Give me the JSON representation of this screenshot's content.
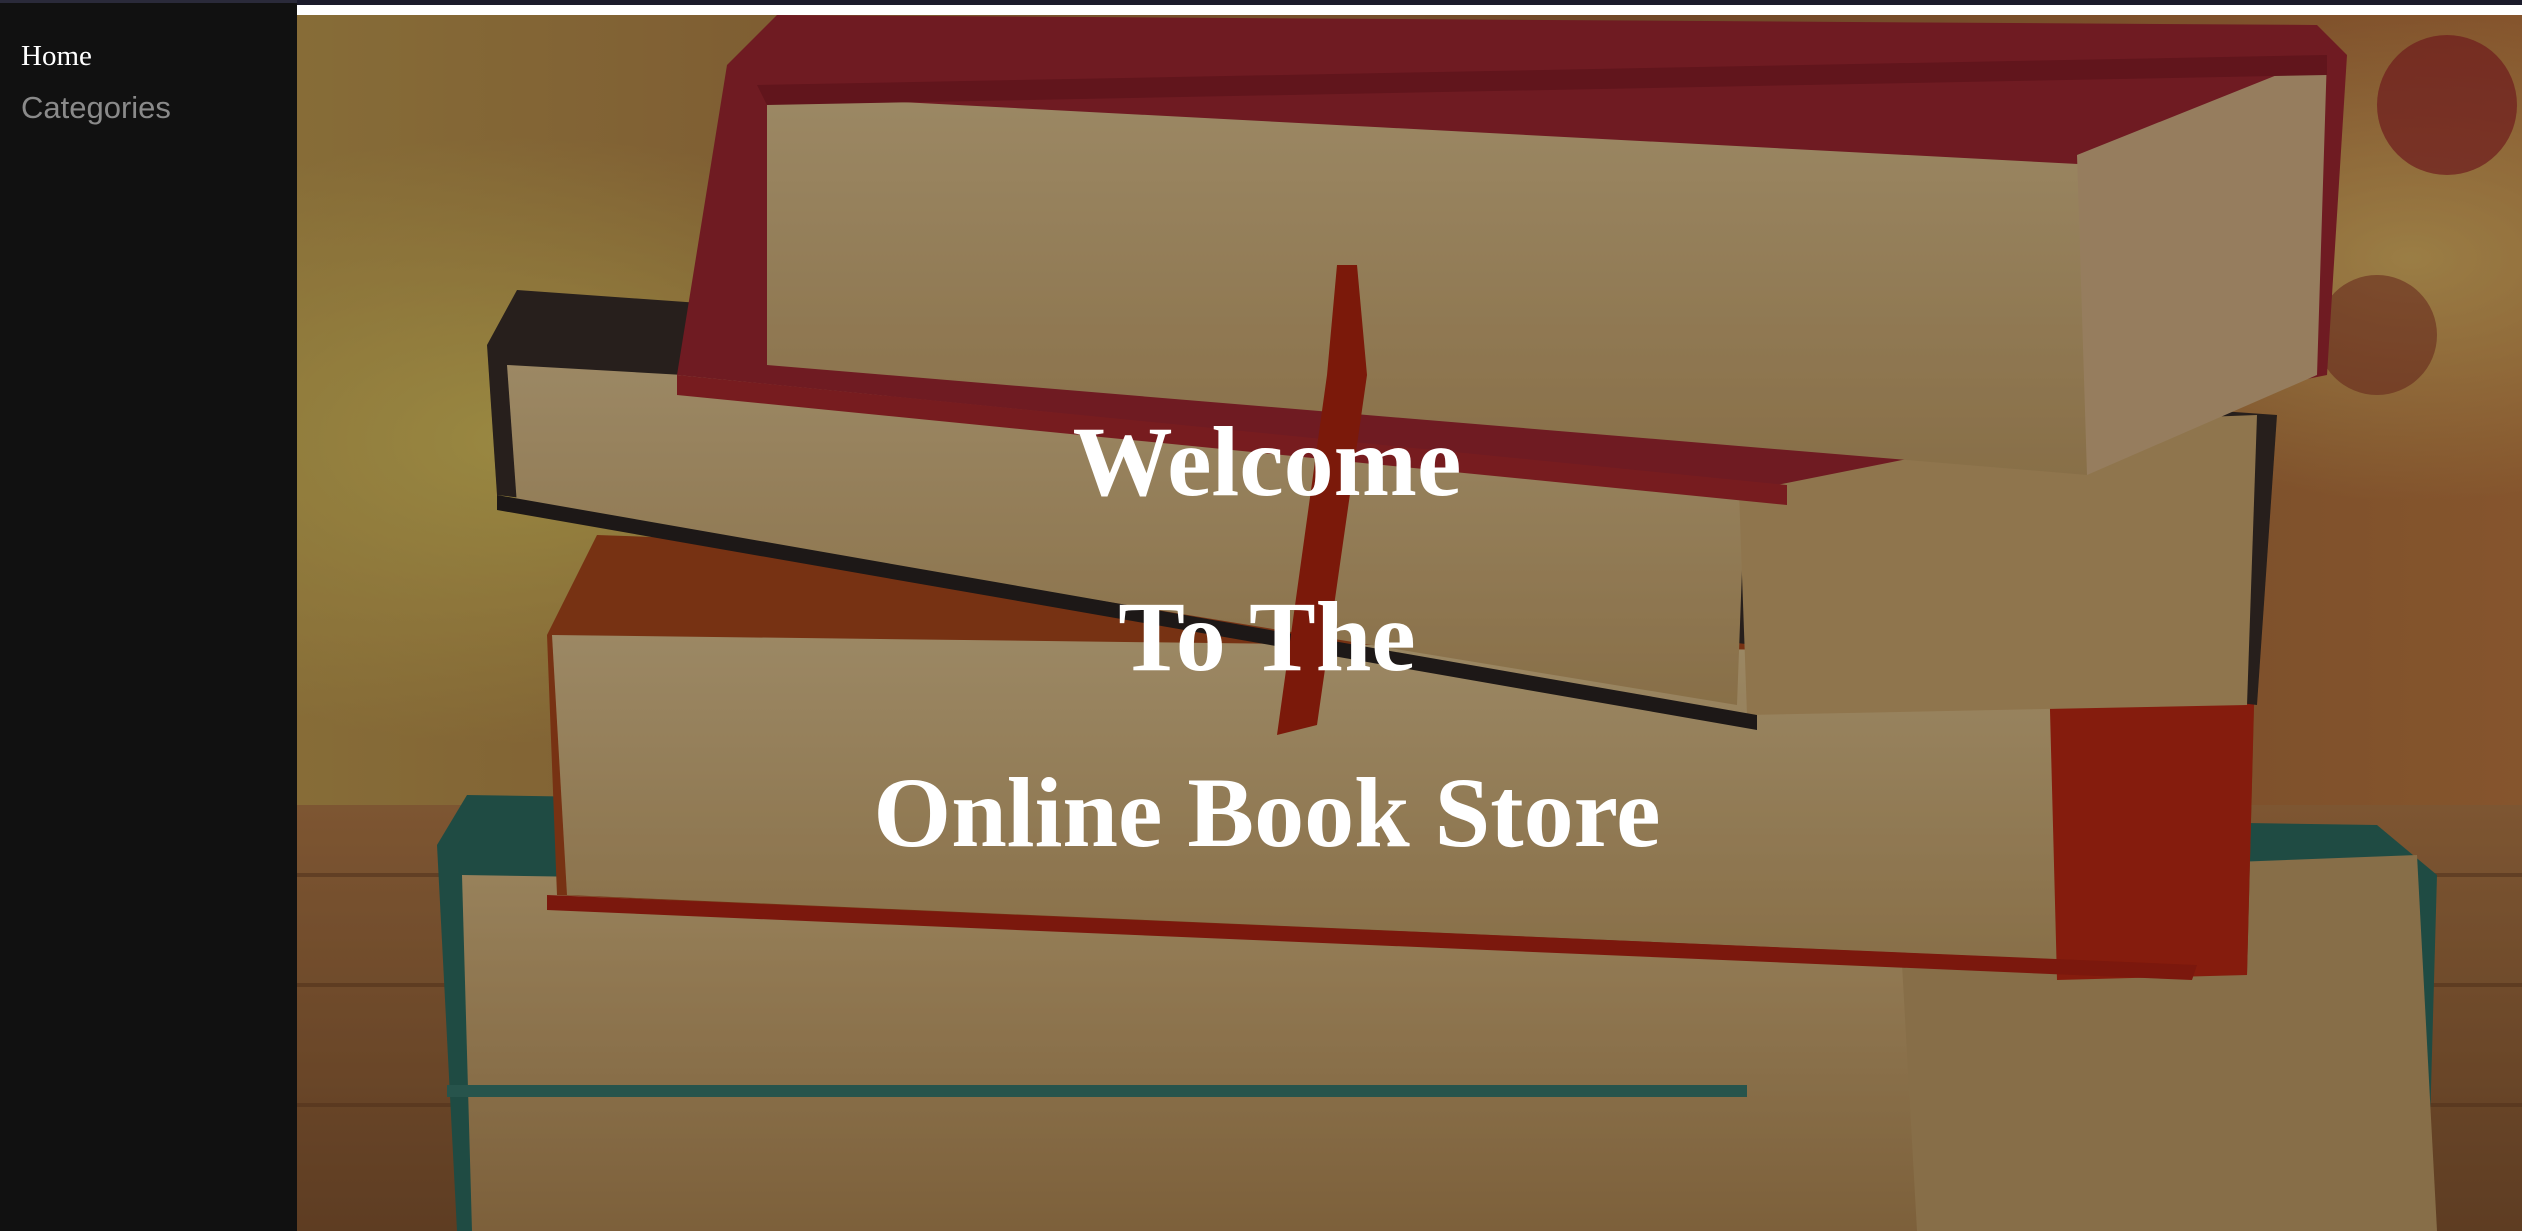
{
  "sidebar": {
    "items": [
      {
        "label": "Home",
        "active": true
      },
      {
        "label": "Categories",
        "active": false
      }
    ]
  },
  "hero": {
    "background_image": "stack-of-books-photo",
    "lines": [
      "Welcome",
      "To The",
      "Online Book Store"
    ]
  },
  "colors": {
    "sidebar_bg": "#111111",
    "active_nav": "#ffffff",
    "inactive_nav": "#8a8a8a",
    "hero_text": "#ffffff"
  }
}
